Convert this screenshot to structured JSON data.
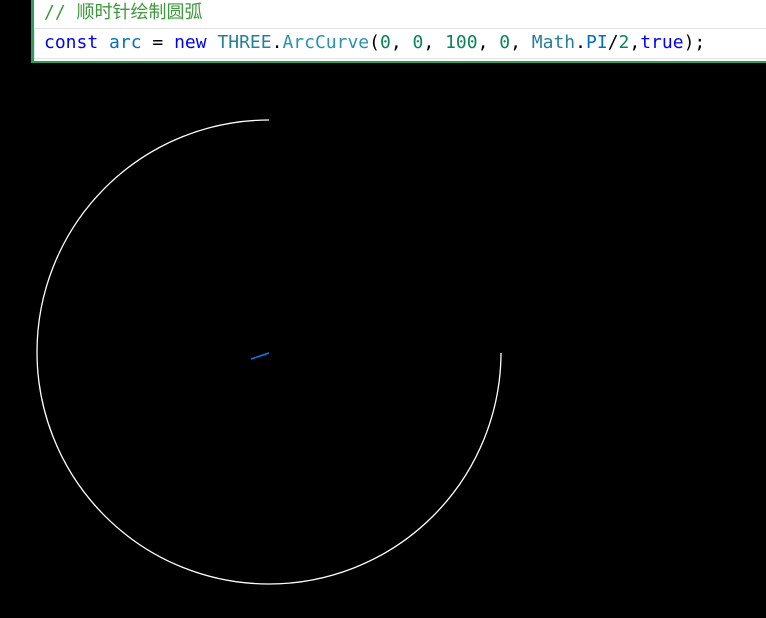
{
  "code": {
    "comment": "// 顺时针绘制圆弧",
    "tokens": [
      {
        "text": "const",
        "kind": "kw"
      },
      {
        "text": " ",
        "kind": "op"
      },
      {
        "text": "arc",
        "kind": "var"
      },
      {
        "text": " = ",
        "kind": "op"
      },
      {
        "text": "new",
        "kind": "kw"
      },
      {
        "text": " ",
        "kind": "op"
      },
      {
        "text": "THREE",
        "kind": "cls"
      },
      {
        "text": ".",
        "kind": "punct"
      },
      {
        "text": "ArcCurve",
        "kind": "fn"
      },
      {
        "text": "(",
        "kind": "punct"
      },
      {
        "text": "0",
        "kind": "num"
      },
      {
        "text": ", ",
        "kind": "punct"
      },
      {
        "text": "0",
        "kind": "num"
      },
      {
        "text": ", ",
        "kind": "punct"
      },
      {
        "text": "100",
        "kind": "num"
      },
      {
        "text": ", ",
        "kind": "punct"
      },
      {
        "text": "0",
        "kind": "num"
      },
      {
        "text": ", ",
        "kind": "punct"
      },
      {
        "text": "Math",
        "kind": "cls"
      },
      {
        "text": ".",
        "kind": "punct"
      },
      {
        "text": "PI",
        "kind": "const"
      },
      {
        "text": "/",
        "kind": "punct"
      },
      {
        "text": "2",
        "kind": "num"
      },
      {
        "text": ",",
        "kind": "punct"
      },
      {
        "text": "true",
        "kind": "kw"
      },
      {
        "text": ");",
        "kind": "punct"
      }
    ]
  },
  "scene": {
    "arc": {
      "radius": 100,
      "start_angle_rad": 0,
      "end_angle_rad": 1.5708,
      "clockwise": true,
      "color": "#ffffff"
    },
    "axes": {
      "x_color_start": "#ff0000",
      "x_color_end": "#ffaa00",
      "y_color_start": "#00ff00",
      "y_color_end": "#aaff00",
      "z_color": "#0080ff"
    },
    "background": "#000000"
  }
}
